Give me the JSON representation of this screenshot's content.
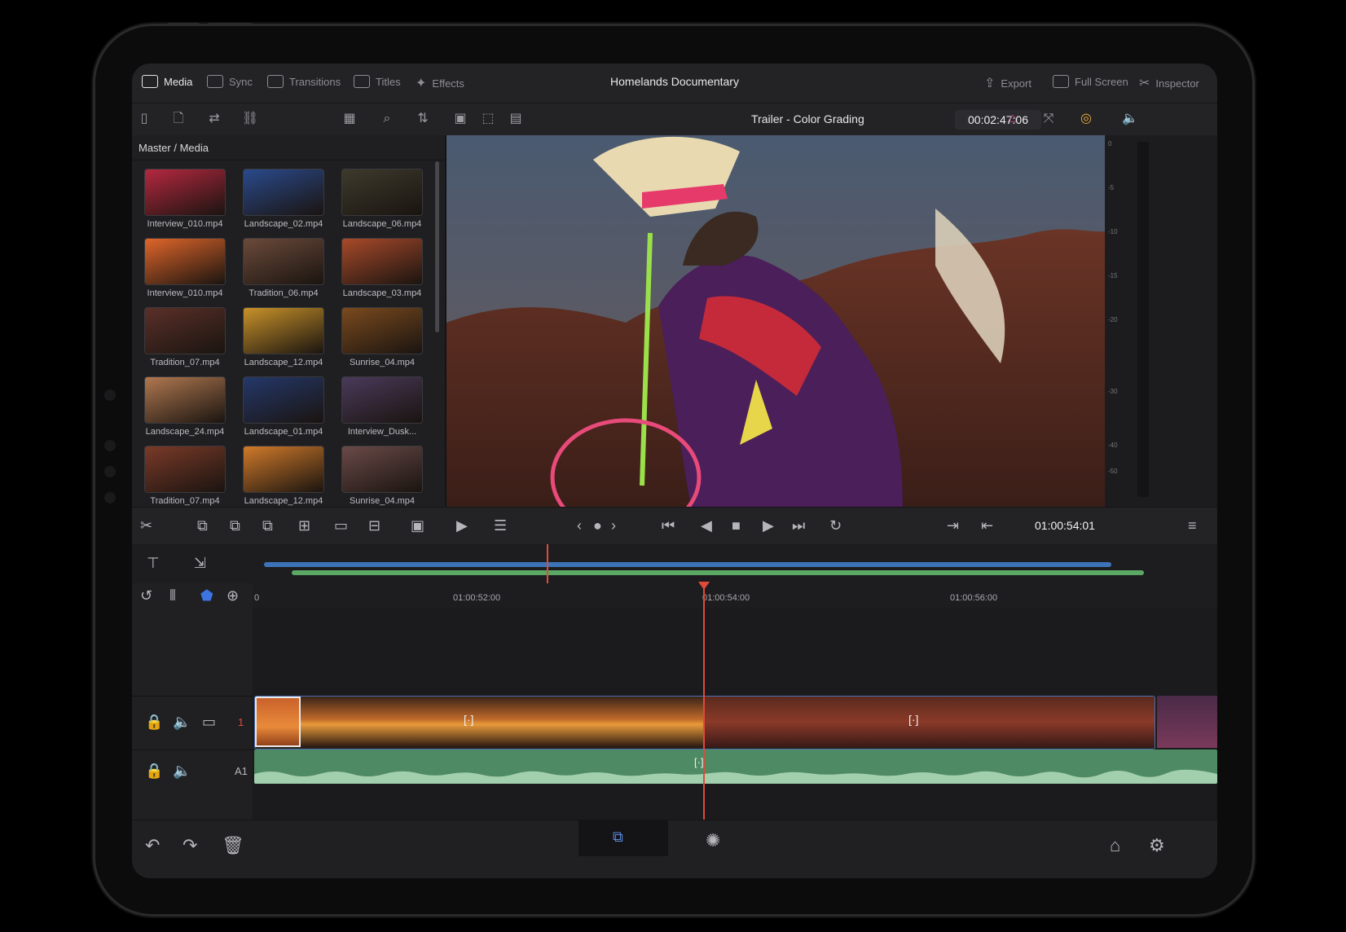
{
  "menu": {
    "items": [
      {
        "label": "Media",
        "icon": "media-icon",
        "active": true
      },
      {
        "label": "Sync",
        "icon": "sync-icon",
        "active": false
      },
      {
        "label": "Transitions",
        "icon": "transitions-icon",
        "active": false
      },
      {
        "label": "Titles",
        "icon": "titles-icon",
        "active": false
      },
      {
        "label": "Effects",
        "icon": "effects-icon",
        "active": false
      }
    ],
    "project_title": "Homelands Documentary",
    "right_items": [
      {
        "label": "Export",
        "icon": "export-icon"
      },
      {
        "label": "Full Screen",
        "icon": "fullscreen-icon"
      },
      {
        "label": "Inspector",
        "icon": "inspector-icon"
      }
    ]
  },
  "viewer": {
    "title": "Trailer - Color Grading",
    "duration": "00:02:47:06"
  },
  "media_pool": {
    "breadcrumb": "Master / Media",
    "clips": [
      {
        "name": "Interview_010.mp4",
        "tone": "#b5283f"
      },
      {
        "name": "Landscape_02.mp4",
        "tone": "#2a4a8c"
      },
      {
        "name": "Landscape_06.mp4",
        "tone": "#3d3a2c"
      },
      {
        "name": "Interview_010.mp4",
        "tone": "#e0662a"
      },
      {
        "name": "Tradition_06.mp4",
        "tone": "#6b4a3a"
      },
      {
        "name": "Landscape_03.mp4",
        "tone": "#a84a2a"
      },
      {
        "name": "Tradition_07.mp4",
        "tone": "#5a3028"
      },
      {
        "name": "Landscape_12.mp4",
        "tone": "#c8922a"
      },
      {
        "name": "Sunrise_04.mp4",
        "tone": "#7a4a1e"
      },
      {
        "name": "Landscape_24.mp4",
        "tone": "#b07850"
      },
      {
        "name": "Landscape_01.mp4",
        "tone": "#24386a"
      },
      {
        "name": "Interview_Dusk...",
        "tone": "#4a3a5a"
      },
      {
        "name": "Tradition_07.mp4",
        "tone": "#7a3a28"
      },
      {
        "name": "Landscape_12.mp4",
        "tone": "#d07a2a"
      },
      {
        "name": "Sunrise_04.mp4",
        "tone": "#6a4a48"
      }
    ]
  },
  "meter": {
    "labels": [
      "0",
      "-5",
      "-10",
      "-15",
      "-20",
      "-30",
      "-40",
      "-50"
    ]
  },
  "transport": {
    "current_timecode": "01:00:54:01"
  },
  "timeline": {
    "ruler_labels": [
      "0",
      "01:00:52:00",
      "01:00:54:00",
      "01:00:56:00"
    ],
    "video_track_number": "1",
    "audio_track_label": "A1"
  },
  "colors": {
    "accent_red": "#e14a3b",
    "audio_green": "#4e8a63",
    "mini_blue": "#3d74b8",
    "mini_green": "#5aa864"
  }
}
